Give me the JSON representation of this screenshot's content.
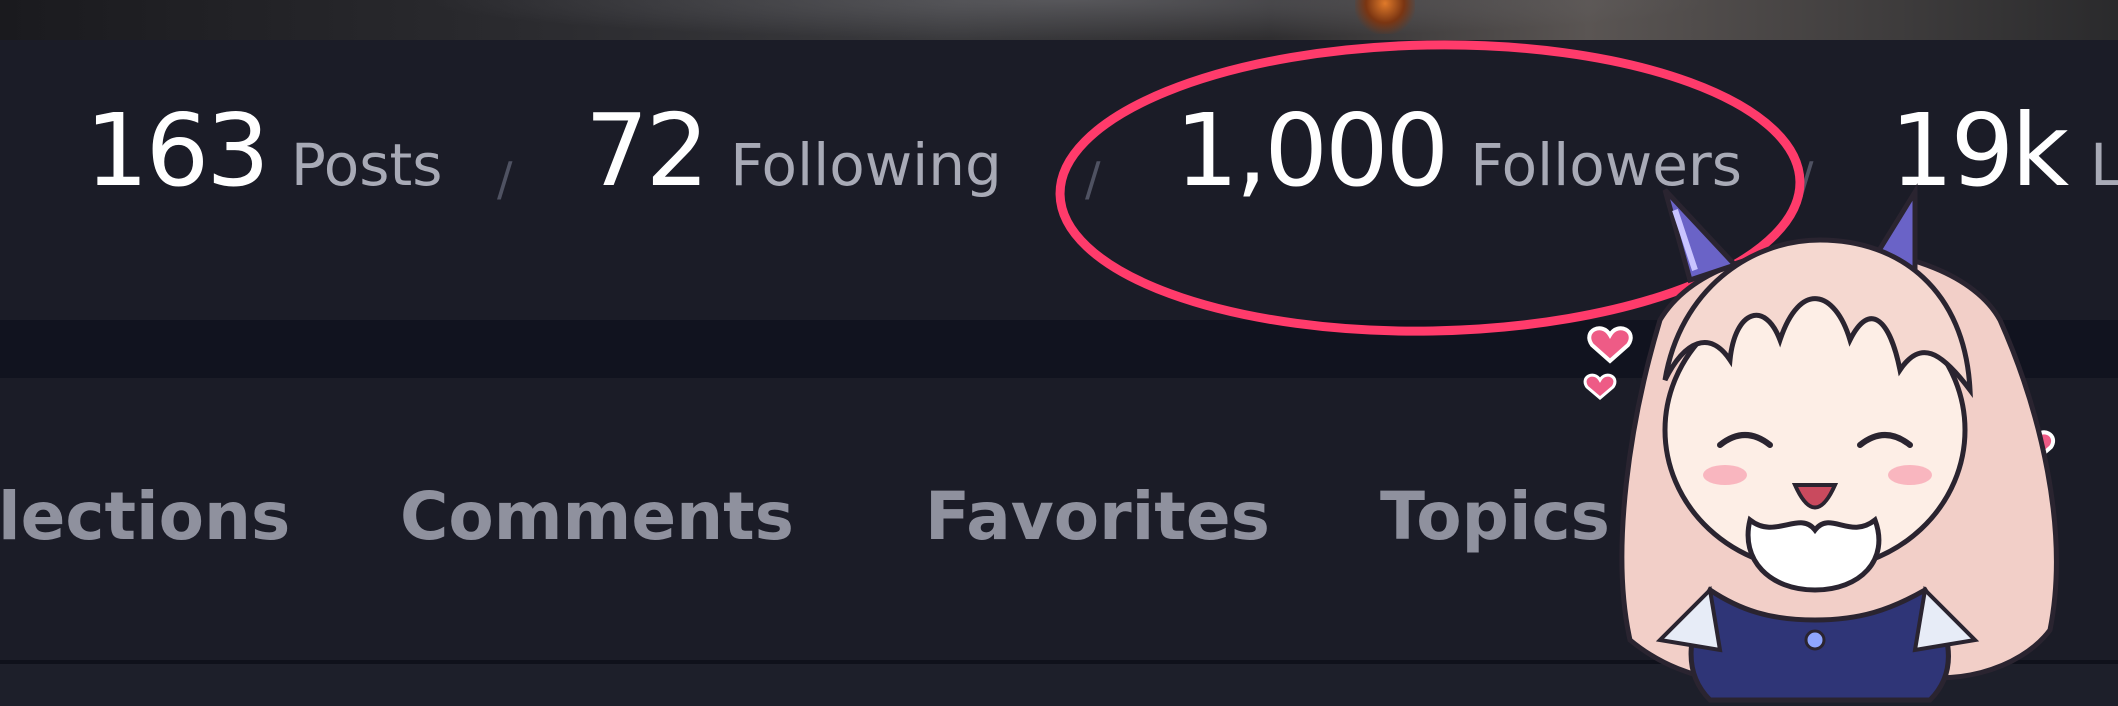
{
  "profile_stats": [
    {
      "value": "163",
      "label": "Posts"
    },
    {
      "value": "72",
      "label": "Following"
    },
    {
      "value": "1,000",
      "label": "Followers"
    },
    {
      "value": "19k",
      "label": "L"
    }
  ],
  "separator": "/",
  "tabs": [
    {
      "label": "lections"
    },
    {
      "label": "Comments"
    },
    {
      "label": "Favorites"
    },
    {
      "label": "Topics"
    }
  ],
  "colors": {
    "background": "#1b1c27",
    "band": "#11131f",
    "stat_number": "#ffffff",
    "stat_label": "#a8aab6",
    "tab_label": "#8f919e",
    "highlight": "#ff3b6b"
  },
  "icons": {
    "mascot": "chibi-girl-sticker-icon",
    "hearts": "heart-icon"
  }
}
